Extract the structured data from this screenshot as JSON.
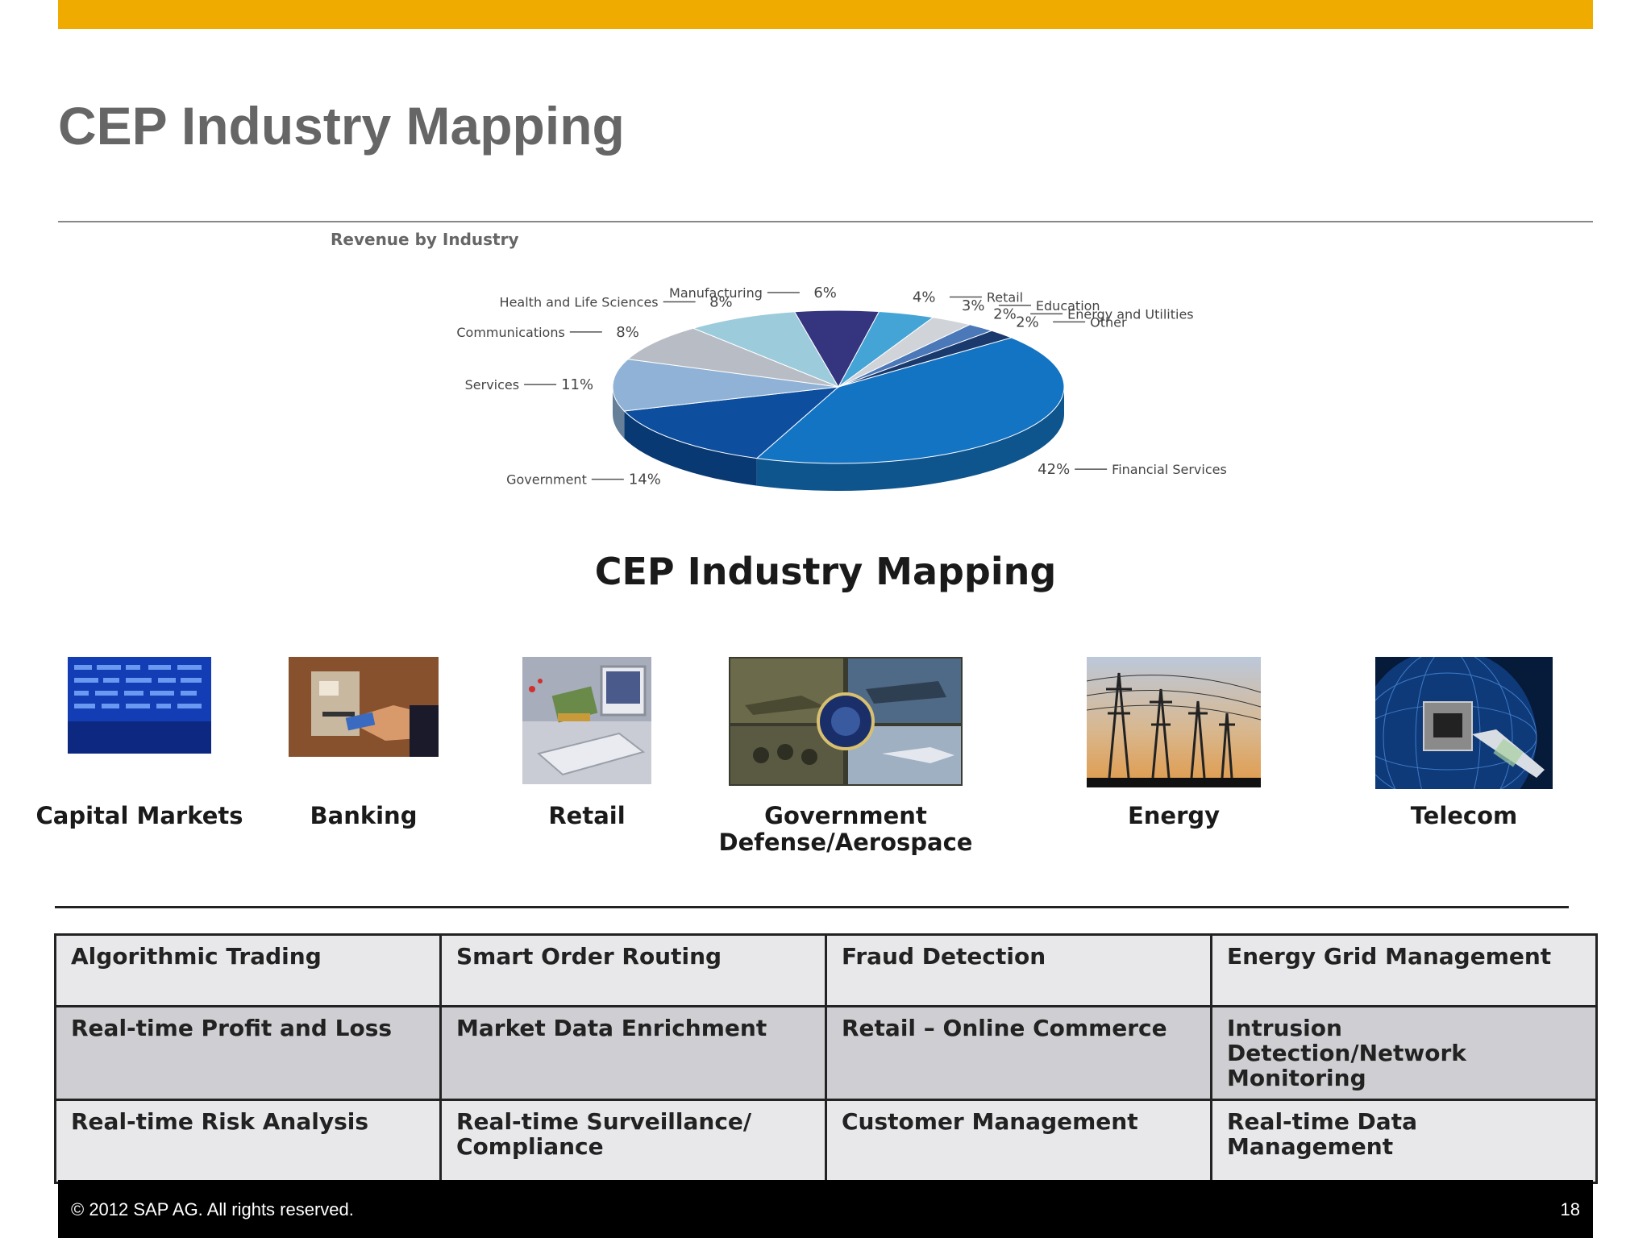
{
  "slide": {
    "title": "CEP Industry Mapping",
    "subtitle": "CEP Industry Mapping"
  },
  "chart_data": {
    "type": "pie",
    "title": "Revenue by Industry",
    "categories": [
      "Financial Services",
      "Government",
      "Services",
      "Communications",
      "Health and Life Sciences",
      "Manufacturing",
      "Retail",
      "Education",
      "Energy and Utilities",
      "Other"
    ],
    "values": [
      42,
      14,
      11,
      8,
      8,
      6,
      4,
      3,
      2,
      2
    ],
    "value_labels": [
      "42%",
      "14%",
      "11%",
      "8%",
      "8%",
      "6%",
      "4%",
      "3%",
      "2%",
      "2%"
    ],
    "colors": [
      "#1474c4",
      "#0d4f9e",
      "#8fb2d6",
      "#b8bcc4",
      "#9ccbdb",
      "#35357f",
      "#45a4d6",
      "#d0d3d8",
      "#4a78b8",
      "#1a3a6e"
    ],
    "style": "3d"
  },
  "industries": [
    {
      "label": "Capital Markets",
      "icon": "stock-ticker-image"
    },
    {
      "label": "Banking",
      "icon": "atm-card-image"
    },
    {
      "label": "Retail",
      "icon": "online-shopping-image"
    },
    {
      "label": "Government Defense/Aerospace",
      "icon": "defense-collage-image"
    },
    {
      "label": "Energy",
      "icon": "power-lines-image"
    },
    {
      "label": "Telecom",
      "icon": "network-cable-image"
    }
  ],
  "use_cases": [
    [
      "Algorithmic Trading",
      "Smart Order Routing",
      "Fraud Detection",
      "Energy Grid Management"
    ],
    [
      "Real-time Profit and Loss",
      "Market Data Enrichment",
      "Retail – Online Commerce",
      "Intrusion Detection/Network Monitoring"
    ],
    [
      "Real-time Risk Analysis",
      "Real-time Surveillance/ Compliance",
      "Customer Management",
      "Real-time Data Management"
    ]
  ],
  "footer": {
    "copyright": "© 2012 SAP AG. All rights reserved.",
    "page": "18"
  },
  "colors": {
    "accent": "#f0ab00",
    "title_gray": "#666666",
    "footer_bg": "#000000"
  }
}
